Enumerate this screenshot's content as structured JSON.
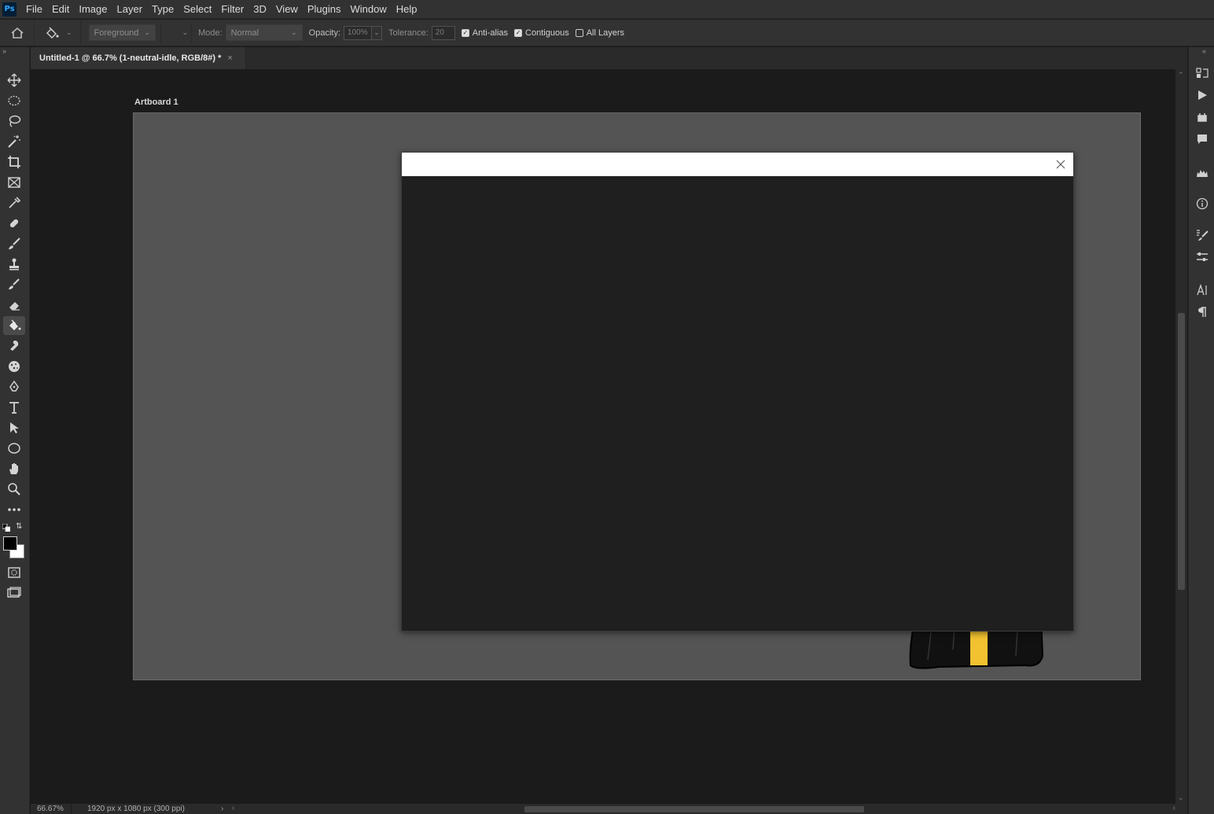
{
  "app": {
    "logo_text": "Ps"
  },
  "menu": [
    "File",
    "Edit",
    "Image",
    "Layer",
    "Type",
    "Select",
    "Filter",
    "3D",
    "View",
    "Plugins",
    "Window",
    "Help"
  ],
  "options": {
    "fill_source": "Foreground",
    "mode_label": "Mode:",
    "mode_value": "Normal",
    "opacity_label": "Opacity:",
    "opacity_value": "100%",
    "tolerance_label": "Tolerance:",
    "tolerance_value": "20",
    "antialias_label": "Anti-alias",
    "antialias_checked": true,
    "contiguous_label": "Contiguous",
    "contiguous_checked": true,
    "all_layers_label": "All Layers",
    "all_layers_checked": false
  },
  "document": {
    "tab_title": "Untitled-1 @ 66.7% (1-neutral-idle, RGB/8#) *",
    "artboard_label": "Artboard 1"
  },
  "status": {
    "zoom": "66.67%",
    "doc_info": "1920 px x 1080 px (300 ppi)"
  },
  "colors": {
    "foreground": "#000000",
    "background": "#ffffff",
    "figure_purple": "#6a1fd0",
    "figure_yellow": "#f2c230"
  },
  "tools": [
    "move-icon",
    "elliptical-marquee-icon",
    "lasso-icon",
    "magic-wand-icon",
    "crop-icon",
    "frame-icon",
    "eyedropper-icon",
    "healing-brush-icon",
    "brush-icon",
    "clone-stamp-icon",
    "history-brush-icon",
    "eraser-icon",
    "paint-bucket-icon",
    "smudge-icon",
    "sponge-icon",
    "pen-icon",
    "type-icon",
    "path-selection-icon",
    "ellipse-icon",
    "hand-icon",
    "zoom-icon",
    "more-tools-icon"
  ]
}
